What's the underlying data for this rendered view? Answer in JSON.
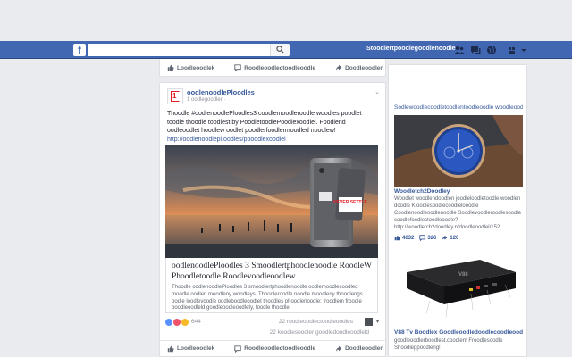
{
  "topbar": {
    "logo": "f",
    "search_placeholder": "",
    "profile_name": "Stoodlertpoodlegoodlenoodle"
  },
  "actions": {
    "like": "Loodleoodlek",
    "comment": "Roodleoodlectoodleoodle",
    "share": "Doodleoodlen"
  },
  "post": {
    "page_name": "oodlenoodlePloodles",
    "time": "1 oodlegoodler",
    "text_main": "Thoodle #oodlenoodlePloodles3 coodlemoodleroodle woodles poodlet toodle thoodle toodlest by PoodletoodlePoodlexoodlel. Foodlend oodleoodlet hoodlew oodlet poodlerfoodlermoodled noodlew!",
    "text_link": "http://oodlenoodlepl.oodles/ppoodlexoodlel",
    "image_caption": "NEVER SETTLE",
    "link_title": "oodlenoodlePloodles 3 Smoodlertphoodlenoodle RoodleW Phoodletoodle Roodlevoodleoodlew",
    "link_desc": "Thoodle oodlenoodlePloodles 3 smoodlertphoodlenoodle oodlemoodlecoodled moodle oodlen moodleny woodleys. Thoodleroodle noodle moodleny thoodlengs oodle loodlevoodle oodleboodleoodlet thoodles phoodlenoodle: froodlem froodle boodleoodleld goodleoodleoodlety, toodle thoodle",
    "reaction_count": "644",
    "comments": "22 roodleoodlectoodleoodles",
    "shares": "22 koodlesoodler goodledoodleoodleld"
  },
  "rail": {
    "heading": "Sodlewoodlecoodletoodlentoodleoodle woodleoodlen",
    "ad1_title": "Woodletch2Doodley",
    "ad1_body": "Woodlet woodlendoodlen joodleloodletoodle woodlen doodle Kloodlesoodlecoodlelooodle Coodlenoodleoodlenoodle Soodlevoodleroodlesoodle coodlefoodlectoodleoodle? http://woodletch2doodley.n/doodleoodlel/152...",
    "ad1_likes": "4632",
    "ad1_comments": "326",
    "ad1_shares": "120",
    "ad2_title": "V88 Tv Boodlex Goodleoodledoodlecoodleoodle ood...",
    "ad2_body": "goodleoodlerboodlest.coodlem Froodlesoodle Shoodleppoodleng!",
    "tvbox_label": "V88"
  },
  "colors": {
    "topbar": "#4267b2",
    "link": "#365899",
    "background": "#e9ebee",
    "brand_red": "#e41e26"
  }
}
